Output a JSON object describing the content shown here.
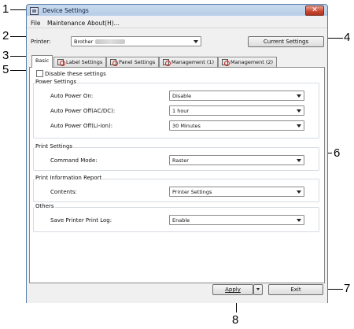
{
  "window": {
    "title": "Device Settings",
    "close_glyph": "✕"
  },
  "menu": [
    "File",
    "Maintenance",
    "About(H)..."
  ],
  "printer": {
    "label": "Printer:",
    "value": "Brother"
  },
  "current_settings_button": "Current Settings",
  "tabs": [
    {
      "label": "Basic",
      "icon": null
    },
    {
      "label": "Label Settings",
      "icon": "disabled-settings-icon"
    },
    {
      "label": "Panel Settings",
      "icon": "disabled-settings-icon"
    },
    {
      "label": "Management (1)",
      "icon": "disabled-settings-icon"
    },
    {
      "label": "Management (2)",
      "icon": "disabled-settings-icon"
    }
  ],
  "disable_checkbox": {
    "label": "Disable these settings",
    "checked": false
  },
  "power": {
    "title": "Power Settings",
    "auto_on": {
      "label": "Auto Power On:",
      "value": "Disable"
    },
    "auto_off_ac": {
      "label": "Auto Power Off(AC/DC):",
      "value": "1 hour"
    },
    "auto_off_li": {
      "label": "Auto Power Off(Li-ion):",
      "value": "30 Minutes"
    }
  },
  "print": {
    "title": "Print Settings",
    "command_mode": {
      "label": "Command Mode:",
      "value": "Raster"
    }
  },
  "report": {
    "title": "Print Information Report",
    "contents": {
      "label": "Contents:",
      "value": "Printer Settings"
    }
  },
  "others": {
    "title": "Others",
    "save_log": {
      "label": "Save Printer Print Log:",
      "value": "Enable"
    }
  },
  "buttons": {
    "apply": "Apply",
    "exit": "Exit"
  },
  "callouts": {
    "c1": "1",
    "c2": "2",
    "c3": "3",
    "c4": "4",
    "c5": "5",
    "c6": "6",
    "c7": "7",
    "c8": "8"
  }
}
